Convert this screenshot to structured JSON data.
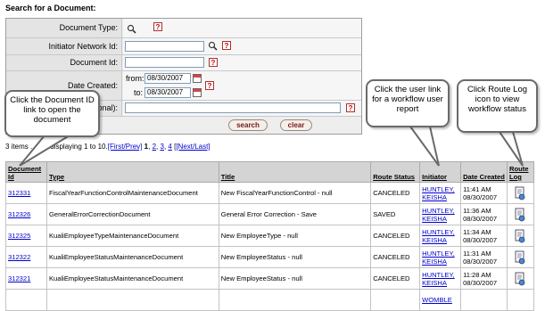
{
  "page": {
    "title": "Search for a Document:"
  },
  "form": {
    "document_type_label": "Document Type:",
    "initiator_label": "Initiator Network Id:",
    "document_id_label": "Document Id:",
    "date_created_label": "Date Created:",
    "from_label": "from:",
    "to_label": "to:",
    "from_value": "08/30/2007",
    "to_value": "08/30/2007",
    "optional_label": "onal):",
    "search_label": "search",
    "clear_label": "clear",
    "help_glyph": "?"
  },
  "results": {
    "summary_partial": "3 items ... ed, displaying 1 to 10.",
    "first_prev": "[First/Prev]",
    "page1": "1",
    "page2": "2",
    "page3": "3",
    "page4": "4",
    "next_last": "[Next/Last]",
    "comma": ",",
    "open_bracket": "["
  },
  "table": {
    "headers": {
      "document_id": "Document Id",
      "type": "Type",
      "title": "Title",
      "route_status": "Route Status",
      "initiator": "Initiator",
      "date_created": "Date Created",
      "route_log": "Route Log"
    },
    "rows": [
      {
        "id": "312331",
        "type": "FiscalYearFunctionControlMaintenanceDocument",
        "title": "New FiscalYearFunctionControl - null",
        "status": "CANCELED",
        "initiator": "HUNTLEY, KEISHA",
        "time": "11:41 AM",
        "date": "08/30/2007"
      },
      {
        "id": "312326",
        "type": "GeneralErrorCorrectionDocument",
        "title": "General Error Correction - Save",
        "status": "SAVED",
        "initiator": "HUNTLEY, KEISHA",
        "time": "11:36 AM",
        "date": "08/30/2007"
      },
      {
        "id": "312325",
        "type": "KualiEmployeeTypeMaintenanceDocument",
        "title": "New EmployeeType - null",
        "status": "CANCELED",
        "initiator": "HUNTLEY, KEISHA",
        "time": "11:34 AM",
        "date": "08/30/2007"
      },
      {
        "id": "312322",
        "type": "KualiEmployeeStatusMaintenanceDocument",
        "title": "New EmployeeStatus - null",
        "status": "CANCELED",
        "initiator": "HUNTLEY, KEISHA",
        "time": "11:31 AM",
        "date": "08/30/2007"
      },
      {
        "id": "312321",
        "type": "KualiEmployeeStatusMaintenanceDocument",
        "title": "New EmployeeStatus - null",
        "status": "CANCELED",
        "initiator": "HUNTLEY, KEISHA",
        "time": "11:28 AM",
        "date": "08/30/2007"
      },
      {
        "id": "",
        "type": "",
        "title": "",
        "status": "",
        "initiator": "WOMBLE",
        "time": "",
        "date": ""
      }
    ]
  },
  "callouts": {
    "doc_id": "Click the Document ID link to open the document",
    "user": "Click the user link for a workflow user report",
    "route_log": "Click Route Log icon to view workflow status"
  },
  "icons": {
    "lookup": "magnifier-icon",
    "help": "help-icon",
    "calendar": "calendar-icon",
    "route_log": "route-log-icon"
  },
  "colors": {
    "link": "#0000cc",
    "button_text": "#7a1818",
    "help_icon": "#cc0000"
  }
}
